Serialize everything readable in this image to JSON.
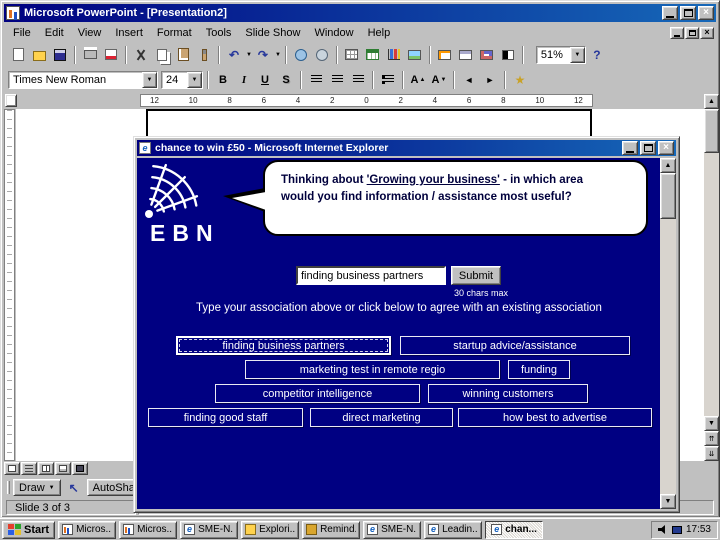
{
  "powerpoint": {
    "title": "Microsoft PowerPoint - [Presentation2]",
    "menus": [
      "File",
      "Edit",
      "View",
      "Insert",
      "Format",
      "Tools",
      "Slide Show",
      "Window",
      "Help"
    ],
    "standard_toolbar": {
      "zoom": "51%"
    },
    "formatting_toolbar": {
      "font_name": "Times New Roman",
      "font_size": "24",
      "bold": "B",
      "italic": "I",
      "underline": "U",
      "shadow": "S",
      "increase_font": "A",
      "decrease_font": "A"
    },
    "ruler_numbers": [
      "12",
      "10",
      "8",
      "6",
      "4",
      "2",
      "0",
      "2",
      "4",
      "6",
      "8",
      "10",
      "12"
    ],
    "drawing_toolbar": {
      "draw": "Draw",
      "autoshapes": "AutoSha"
    },
    "status_bar": {
      "slide": "Slide 3 of 3"
    }
  },
  "ie": {
    "title": "chance to win £50 - Microsoft Internet Explorer",
    "logo": "EBN",
    "question": {
      "pre": "Thinking about ",
      "underlined": "'Growing your business'",
      "post": " - in which area",
      "line2": "would you find information / assistance most useful?"
    },
    "input_value": "finding business partners",
    "submit": "Submit",
    "hint": "30 chars max",
    "instruction": "Type your association above or click below to agree with an existing association",
    "options": [
      "finding business partners",
      "startup advice/assistance",
      "marketing test in remote regio",
      "funding",
      "competitor intelligence",
      "winning customers",
      "finding good staff",
      "direct marketing",
      "how best to advertise"
    ]
  },
  "taskbar": {
    "start": "Start",
    "tasks": [
      "Micros...",
      "Micros...",
      "SME-N...",
      "Explori...",
      "Remind...",
      "SME-N...",
      "Leadin...",
      "chan..."
    ],
    "clock": "17:53"
  },
  "icons": {
    "close": "×",
    "dropdown_small": "▼",
    "undo": "↶",
    "redo": "↷",
    "promote": "◄",
    "demote": "►",
    "up_arrow": "▲",
    "down_arrow": "▼",
    "double_up": "⇈",
    "double_down": "⇊",
    "star": "★",
    "pointer": "↖",
    "assistant": "?",
    "ie_glyph": "e"
  },
  "colors": {
    "page_navy": "#000082",
    "titlebar_blue": "#000080",
    "window_gray": "#c0c0c0"
  }
}
